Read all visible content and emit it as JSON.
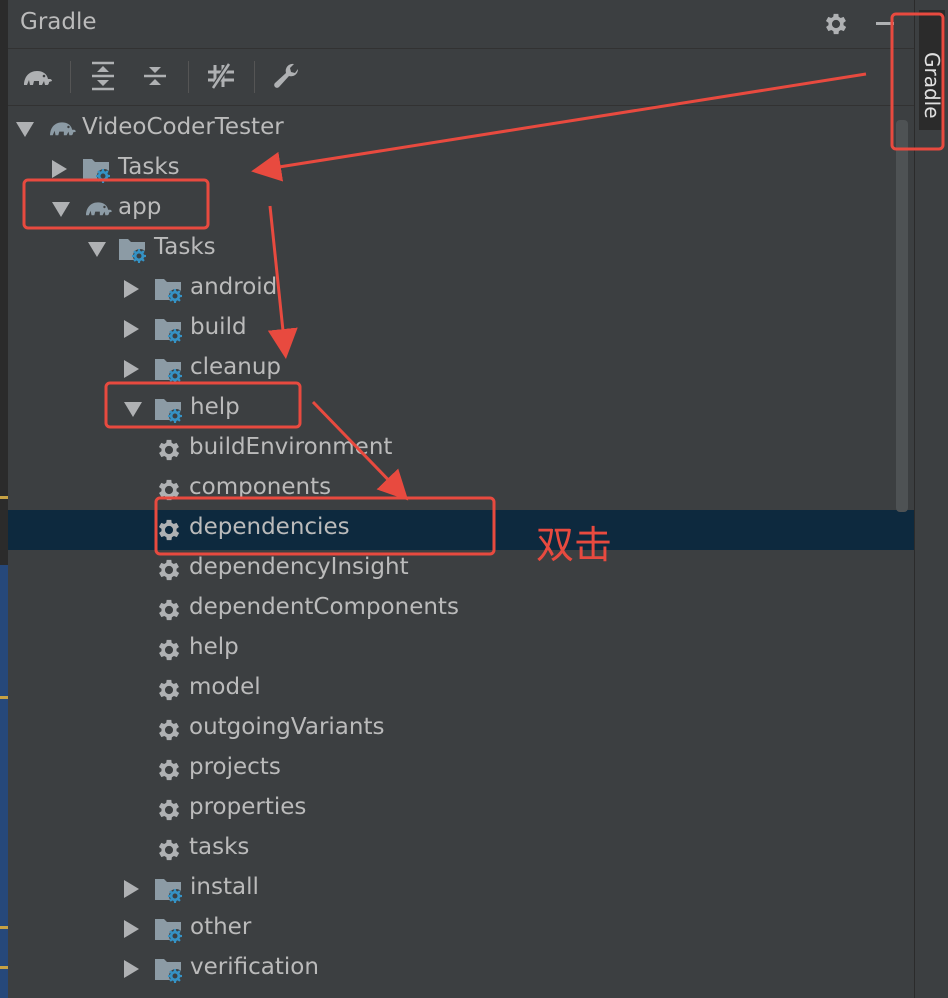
{
  "panel": {
    "title": "Gradle",
    "side_tab_label": "Gradle"
  },
  "toolbar": {
    "buttons": [
      {
        "name": "refresh-gradle-button",
        "icon": "elephant-refresh-icon"
      },
      {
        "name": "expand-all-button",
        "icon": "expand-all-icon"
      },
      {
        "name": "collapse-all-button",
        "icon": "collapse-all-icon"
      },
      {
        "name": "toggle-offline-button",
        "icon": "offline-icon"
      },
      {
        "name": "build-settings-button",
        "icon": "wrench-icon"
      }
    ]
  },
  "tree": {
    "root": "VideoCoderTester",
    "root_tasks": "Tasks",
    "app": "app",
    "app_tasks": "Tasks",
    "groups": [
      "android",
      "build",
      "cleanup",
      "help"
    ],
    "help_tasks": [
      "buildEnvironment",
      "components",
      "dependencies",
      "dependencyInsight",
      "dependentComponents",
      "help",
      "model",
      "outgoingVariants",
      "projects",
      "properties",
      "tasks"
    ],
    "groups_after": [
      "install",
      "other",
      "verification"
    ],
    "selected": "dependencies"
  },
  "annotation": {
    "text": "双击",
    "color": "#e84a3f"
  }
}
